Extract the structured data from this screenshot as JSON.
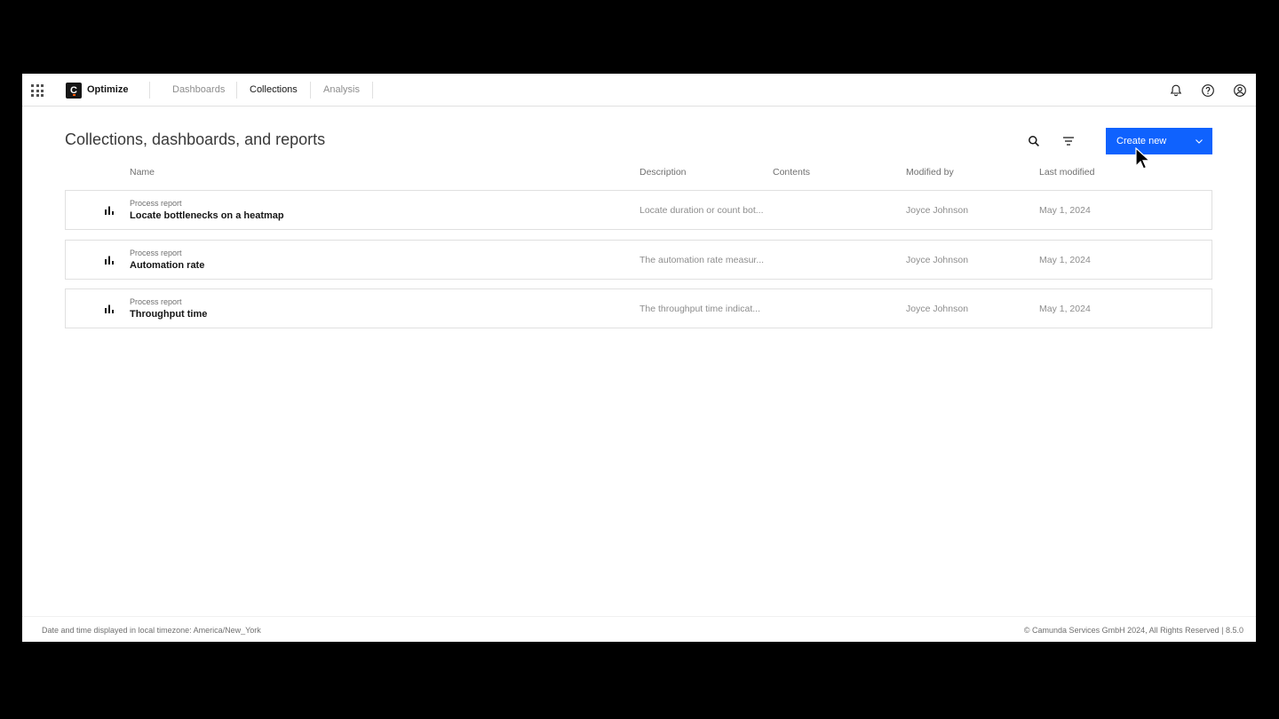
{
  "header": {
    "app_name": "Optimize",
    "logo_letter": "C",
    "nav": [
      {
        "label": "Dashboards",
        "active": false
      },
      {
        "label": "Collections",
        "active": true
      },
      {
        "label": "Analysis",
        "active": false
      }
    ],
    "icons": [
      "app-switcher-icon",
      "bell-icon",
      "help-icon",
      "user-icon"
    ]
  },
  "main": {
    "title": "Collections, dashboards, and reports",
    "create_button_label": "Create new",
    "columns": [
      "Name",
      "Description",
      "Contents",
      "Modified by",
      "Last modified"
    ],
    "rows": [
      {
        "type": "Process report",
        "name": "Locate bottlenecks on a heatmap",
        "description": "Locate duration or count bot...",
        "modified_by": "Joyce Johnson",
        "last_modified": "May 1, 2024",
        "icon": "bar-chart-icon"
      },
      {
        "type": "Process report",
        "name": "Automation rate",
        "description": "The automation rate measur...",
        "modified_by": "Joyce Johnson",
        "last_modified": "May 1, 2024",
        "icon": "bar-chart-icon"
      },
      {
        "type": "Process report",
        "name": "Throughput time",
        "description": "The throughput time indicat...",
        "modified_by": "Joyce Johnson",
        "last_modified": "May 1, 2024",
        "icon": "bar-chart-icon"
      }
    ]
  },
  "footer": {
    "timezone_note": "Date and time displayed in local timezone: America/New_York",
    "copyright": "© Camunda Services GmbH 2024, All Rights Reserved | 8.5.0"
  },
  "colors": {
    "accent": "#0f62fe",
    "logo_bg": "#161616",
    "logo_accent": "#fc5d0d"
  }
}
